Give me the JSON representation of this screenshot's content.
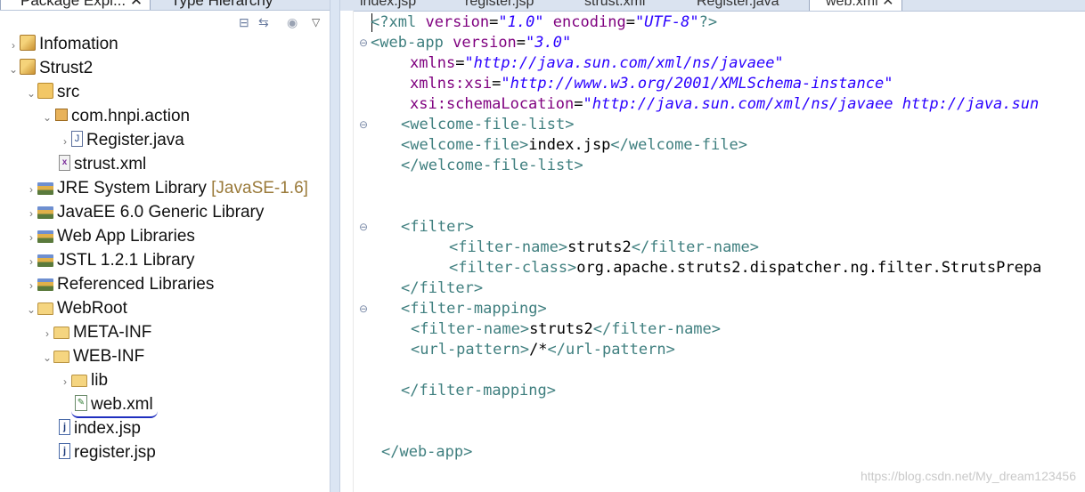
{
  "explorer": {
    "tabs": [
      {
        "label": "Package Expl..."
      },
      {
        "label": "Type Hierarchy"
      }
    ],
    "toolbar": [
      {
        "icon": "collapse-all-icon"
      },
      {
        "icon": "link-editor-icon"
      },
      {
        "icon": "focus-icon"
      },
      {
        "icon": "view-menu-chevron-icon"
      }
    ],
    "tree": [
      {
        "label": "Infomation",
        "icon": "project-icon",
        "arrow": "›"
      },
      {
        "label": "Strust2",
        "icon": "project-icon",
        "arrow": "⌄"
      },
      {
        "label": "src",
        "icon": "source-folder-icon",
        "arrow": "⌄"
      },
      {
        "label": "com.hnpi.action",
        "icon": "package-icon",
        "arrow": "⌄"
      },
      {
        "label": "Register.java",
        "icon": "java-file-icon",
        "arrow": "›"
      },
      {
        "label": "strust.xml",
        "icon": "xml-file-icon",
        "arrow": ""
      },
      {
        "label": "JRE System Library",
        "decoration": "[JavaSE-1.6]",
        "icon": "library-icon",
        "arrow": "›"
      },
      {
        "label": "JavaEE 6.0 Generic Library",
        "icon": "library-icon",
        "arrow": "›"
      },
      {
        "label": "Web App Libraries",
        "icon": "library-icon",
        "arrow": "›"
      },
      {
        "label": "JSTL 1.2.1 Library",
        "icon": "library-icon",
        "arrow": "›"
      },
      {
        "label": "Referenced Libraries",
        "icon": "library-icon",
        "arrow": "›"
      },
      {
        "label": "WebRoot",
        "icon": "folder-icon",
        "arrow": "⌄"
      },
      {
        "label": "META-INF",
        "icon": "folder-icon",
        "arrow": "›"
      },
      {
        "label": "WEB-INF",
        "icon": "folder-icon",
        "arrow": "⌄"
      },
      {
        "label": "lib",
        "icon": "folder-icon",
        "arrow": "›"
      },
      {
        "label": "web.xml",
        "icon": "web-xml-file-icon",
        "arrow": ""
      },
      {
        "label": "index.jsp",
        "icon": "jsp-file-icon",
        "arrow": ""
      },
      {
        "label": "register.jsp",
        "icon": "jsp-file-icon",
        "arrow": ""
      }
    ]
  },
  "editor": {
    "tabs": [
      {
        "label": "index.jsp"
      },
      {
        "label": "register.jsp"
      },
      {
        "label": "strust.xml"
      },
      {
        "label": "Register.java"
      },
      {
        "label": "web.xml"
      }
    ],
    "code": {
      "l1": {
        "open": "<?",
        "name": "xml",
        "a1": "version",
        "v1": "\"1.0\"",
        "a2": "encoding",
        "v2": "\"UTF-8\"",
        "close": "?>"
      },
      "l2": {
        "open": "<web-app",
        "a1": "version",
        "v1": "\"3.0\""
      },
      "l3": {
        "a": "xmlns",
        "v": "\"http://java.sun.com/xml/ns/javaee\""
      },
      "l4": {
        "a": "xmlns:xsi",
        "v": "\"http://www.w3.org/2001/XMLSchema-instance\""
      },
      "l5": {
        "a": "xsi:schemaLocation",
        "v": "\"http://java.sun.com/xml/ns/javaee http://java.sun"
      },
      "l6": {
        "t": "<welcome-file-list>"
      },
      "l7": {
        "o": "<welcome-file>",
        "x": "index.jsp",
        "c": "</welcome-file>"
      },
      "l8": {
        "t": "</welcome-file-list>"
      },
      "l9": {
        "t": "<filter>"
      },
      "l10": {
        "o": "<filter-name>",
        "x": "struts2",
        "c": "</filter-name>"
      },
      "l11": {
        "o": "<filter-class>",
        "x": "org.apache.struts2.dispatcher.ng.filter.StrutsPrepa"
      },
      "l12": {
        "t": "</filter>"
      },
      "l13": {
        "t": "<filter-mapping>"
      },
      "l14": {
        "o": "<filter-name>",
        "x": "struts2",
        "c": "</filter-name>"
      },
      "l15": {
        "o": "<url-pattern>",
        "x": "/*",
        "c": "</url-pattern>"
      },
      "l16": {
        "t": "</filter-mapping>"
      },
      "l17": {
        "t": "</web-app>"
      }
    },
    "watermark": "https://blog.csdn.net/My_dream123456"
  },
  "colors": {
    "tag": "#3f7f7f",
    "attribute": "#7f007f",
    "value": "#2a00ff",
    "text": "#000000",
    "underline": "#1f2fbf"
  }
}
